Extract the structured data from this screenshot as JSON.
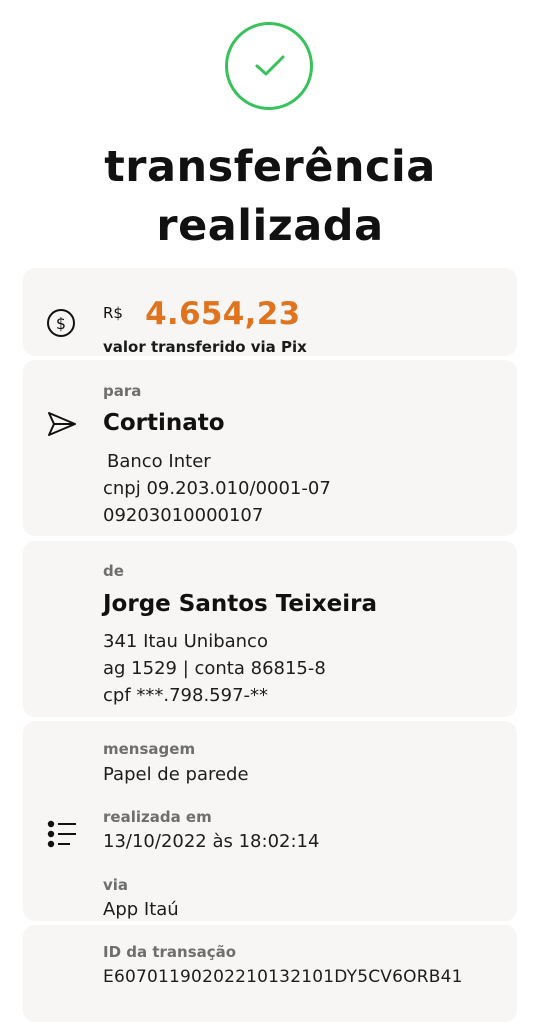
{
  "header": {
    "title_line1": "transferência",
    "title_line2": "realizada"
  },
  "amount": {
    "currency": "R$",
    "value": "4.654,23",
    "caption": "valor transferido via Pix"
  },
  "recipient": {
    "label": "para",
    "name": "Cortinato",
    "bank": "Banco Inter",
    "cnpj": "cnpj 09.203.010/0001-07",
    "account": "09203010000107"
  },
  "sender": {
    "label": "de",
    "name": "Jorge Santos Teixeira",
    "bank": "341 Itau Unibanco",
    "account": "ag 1529 | conta 86815-8",
    "cpf": "cpf ***.798.597-**"
  },
  "details": {
    "message_label": "mensagem",
    "message_value": "Papel de parede",
    "date_label": "realizada em",
    "date_value": "13/10/2022 às 18:02:14",
    "channel_label": "via",
    "channel_value": "App Itaú",
    "id_label": "ID da transação",
    "id_value": "E60701190202210132101DY5CV6ORB41"
  },
  "colors": {
    "success": "#37c25a",
    "amount": "#e0731e",
    "card_background": "#f7f6f4"
  },
  "icons": {
    "status": "check-circle-icon",
    "amount": "dollar-circle-icon",
    "recipient": "send-icon",
    "details": "list-icon"
  }
}
